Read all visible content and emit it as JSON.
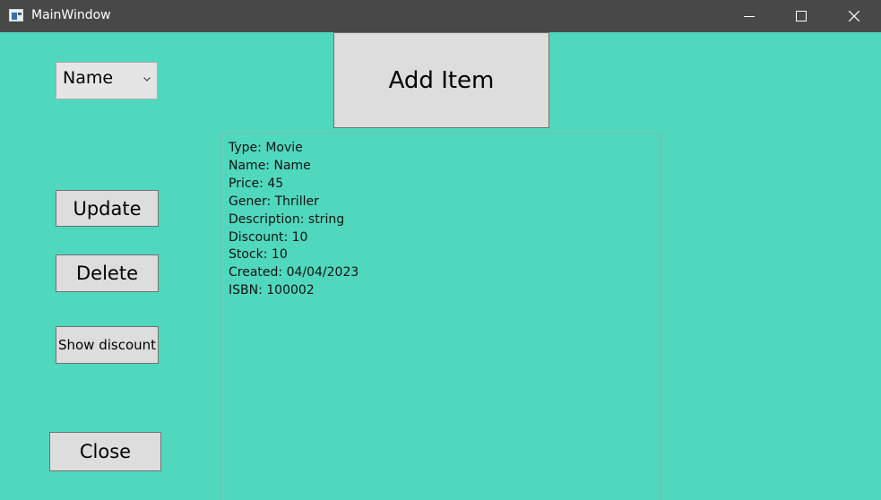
{
  "window": {
    "title": "MainWindow",
    "minimize_icon": "minimize-icon",
    "maximize_icon": "maximize-icon",
    "close_icon": "close-icon"
  },
  "sort_combo": {
    "selected": "Name"
  },
  "buttons": {
    "add_item": "Add Item",
    "update": "Update",
    "delete": "Delete",
    "show_discount": "Show discount",
    "close": "Close"
  },
  "item_details": [
    "Type: Movie",
    "Name: Name",
    "Price: 45",
    "Gener: Thriller",
    "Description: string",
    "Discount: 10",
    "Stock: 10",
    "Created: 04/04/2023",
    "ISBN: 100002"
  ],
  "colors": {
    "background": "#4fd8be",
    "titlebar": "#484848",
    "button": "#dddddd"
  }
}
